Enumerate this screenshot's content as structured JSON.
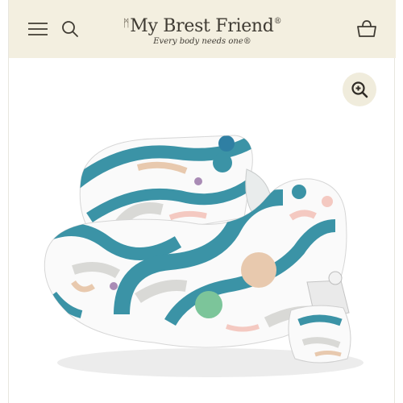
{
  "header": {
    "brand_name": "My Brest Friend",
    "brand_mark": "ᛗ",
    "tagline": "Every body needs one®",
    "menu_icon": "hamburger-menu-icon",
    "search_icon": "search-icon",
    "cart_icon": "basket-icon",
    "background": "#f3efe0"
  },
  "gallery": {
    "zoom_icon": "zoom-in-icon",
    "product_image": "nursing-pillow-photo",
    "pattern_colors": [
      "#3b93a6",
      "#e8c9ae",
      "#d9d9d6",
      "#f4c9c1",
      "#7cc59a",
      "#a98bb5"
    ]
  }
}
